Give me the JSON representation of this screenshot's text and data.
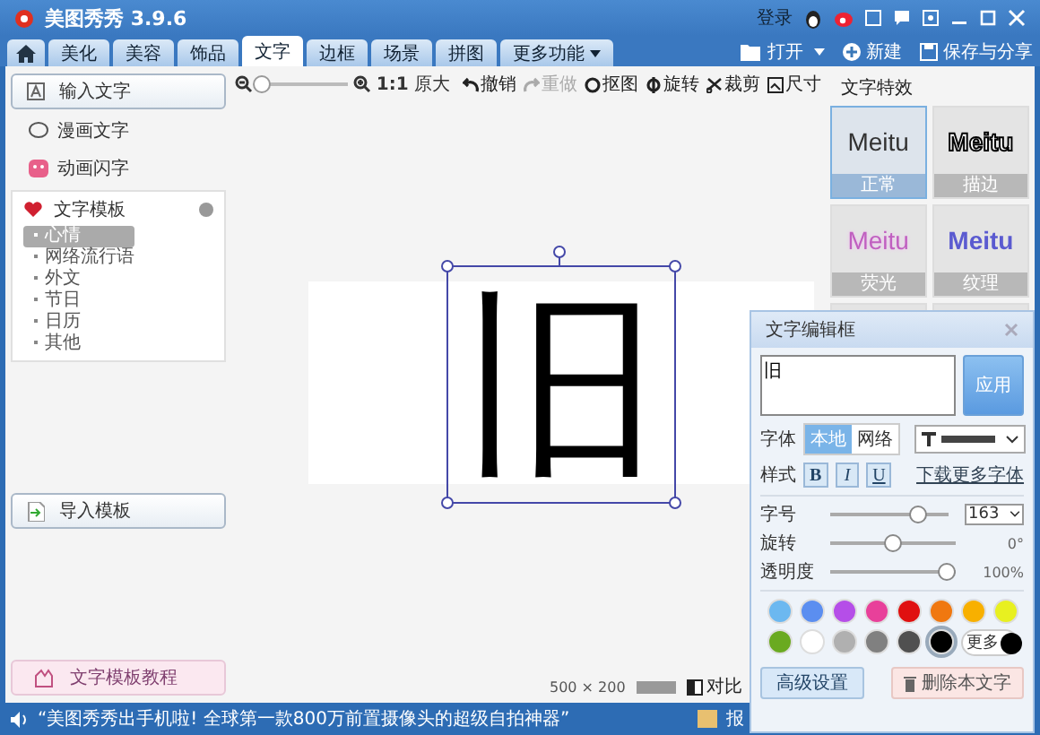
{
  "window": {
    "title": "美图秀秀 3.9.6",
    "login": "登录"
  },
  "tabs": [
    {
      "label": "美化",
      "selected": false
    },
    {
      "label": "美容",
      "selected": false
    },
    {
      "label": "饰品",
      "selected": false
    },
    {
      "label": "文字",
      "selected": true
    },
    {
      "label": "边框",
      "selected": false
    },
    {
      "label": "场景",
      "selected": false
    },
    {
      "label": "拼图",
      "selected": false
    },
    {
      "label": "更多功能",
      "selected": false
    }
  ],
  "file_actions": {
    "open": "打开",
    "new": "新建",
    "save": "保存与分享"
  },
  "sidebar": {
    "input_button": "输入文字",
    "items": [
      "漫画文字",
      "动画闪字"
    ],
    "template": {
      "title": "文字模板",
      "items": [
        {
          "label": "心情",
          "selected": true
        },
        {
          "label": "网络流行语",
          "selected": false
        },
        {
          "label": "外文",
          "selected": false
        },
        {
          "label": "节日",
          "selected": false
        },
        {
          "label": "日历",
          "selected": false
        },
        {
          "label": "其他",
          "selected": false
        }
      ]
    },
    "import_button": "导入模板",
    "tutorial": "文字模板教程"
  },
  "toolbar": {
    "zoom": {
      "level": 0.02
    },
    "actual_size": "原大",
    "actual_size_icon": "1:1",
    "tools": [
      {
        "label": "撤销",
        "disabled": false
      },
      {
        "label": "重做",
        "disabled": true
      },
      {
        "label": "抠图",
        "disabled": false
      },
      {
        "label": "旋转",
        "disabled": false
      },
      {
        "label": "裁剪",
        "disabled": false
      },
      {
        "label": "尺寸",
        "disabled": false
      }
    ]
  },
  "canvas": {
    "text": "旧",
    "size": "500 × 200",
    "compare": "对比"
  },
  "effects": {
    "title": "文字特效",
    "items": [
      {
        "sample": "Meitu",
        "label": "正常",
        "kind": "plain",
        "selected": true
      },
      {
        "sample": "Meitu",
        "label": "描边",
        "kind": "outline",
        "selected": false
      },
      {
        "sample": "Meitu",
        "label": "荧光",
        "kind": "glow",
        "selected": false
      },
      {
        "sample": "Meitu",
        "label": "纹理",
        "kind": "texture",
        "selected": false
      }
    ]
  },
  "editor": {
    "title": "文字编辑框",
    "text": "旧",
    "apply": "应用",
    "font_label": "字体",
    "font_sources": [
      {
        "label": "本地",
        "selected": true
      },
      {
        "label": "网络",
        "selected": false
      }
    ],
    "style_label": "样式",
    "styles": [
      "B",
      "I",
      "U"
    ],
    "download_link": "下载更多字体",
    "sliders": [
      {
        "label": "字号",
        "level": 0.78,
        "value": "163",
        "kind": "select"
      },
      {
        "label": "旋转",
        "level": 0.5,
        "value": "0°",
        "kind": "text"
      },
      {
        "label": "透明度",
        "level": 1.0,
        "value": "100%",
        "kind": "text"
      }
    ],
    "colors": [
      {
        "color": "#6cb8f0",
        "selected": false
      },
      {
        "color": "#5b8ef0",
        "selected": false
      },
      {
        "color": "#b54ee8",
        "selected": false
      },
      {
        "color": "#e8409a",
        "selected": false
      },
      {
        "color": "#e01010",
        "selected": false
      },
      {
        "color": "#f07810",
        "selected": false
      },
      {
        "color": "#f8b000",
        "selected": false
      },
      {
        "color": "#e8f020",
        "selected": false
      },
      {
        "color": "#6aaa20",
        "selected": false
      },
      {
        "color": "#ffffff",
        "selected": false
      },
      {
        "color": "#b0b0b0",
        "selected": false
      },
      {
        "color": "#808080",
        "selected": false
      },
      {
        "color": "#505050",
        "selected": false
      },
      {
        "color": "#000000",
        "selected": true
      }
    ],
    "more": "更多",
    "advanced": "高级设置",
    "delete": "删除本文字"
  },
  "status_bar": {
    "message": "“美图秀秀出手机啦! 全球第一款800万前置摄像头的超级自拍神器”",
    "right": "报"
  }
}
